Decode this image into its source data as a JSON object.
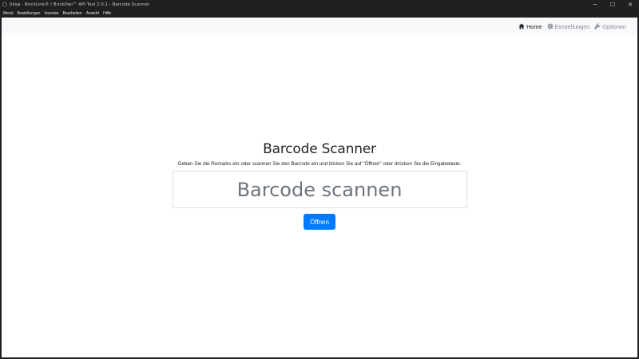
{
  "window": {
    "title": "bliqa - BrickLink® / BrickOwl™ API Tool 2.0.1 - Barcode Scanner",
    "controls": {
      "minimize": "─",
      "maximize": "☐",
      "close": "✕"
    }
  },
  "menubar": {
    "items": [
      {
        "label": "Menü"
      },
      {
        "label": "Bestellungen"
      },
      {
        "label": "Inventar"
      },
      {
        "label": "Bearbeiten"
      },
      {
        "label": "Ansicht"
      },
      {
        "label": "Hilfe"
      }
    ]
  },
  "navbar": {
    "home": {
      "label": "Home",
      "icon": "home-icon"
    },
    "settings": {
      "label": "Einstellungen",
      "icon": "gear-icon"
    },
    "options": {
      "label": "Optionen",
      "icon": "wrench-icon"
    }
  },
  "main": {
    "title": "Barcode Scanner",
    "instructions": "Geben Sie die Remarks ein oder scannen Sie den Barcode ein und klicken Sie auf \"Öffnen\" oder drücken Sie die Eingabetaste.",
    "barcode_input": {
      "value": "",
      "placeholder": "Barcode scannen"
    },
    "open_label": "Öffnen"
  },
  "colors": {
    "accent": "#007bff",
    "navbar_bg": "#f8f9fa",
    "chrome_bg": "#202020"
  }
}
